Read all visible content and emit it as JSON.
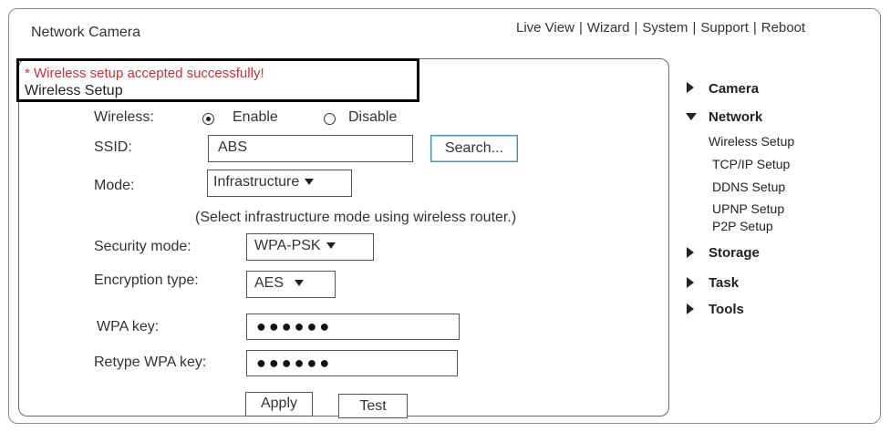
{
  "header": {
    "title": "Network Camera",
    "nav": [
      "Live View",
      "Wizard",
      "System",
      "Support",
      "Reboot"
    ]
  },
  "form": {
    "message": "* Wireless setup accepted successfully!",
    "section_title": "Wireless Setup",
    "wireless_label": "Wireless:",
    "enable_label": "Enable",
    "disable_label": "Disable",
    "wireless_selected": "Enable",
    "ssid_label": "SSID:",
    "ssid_value": "ABS",
    "search_label": "Search...",
    "mode_label": "Mode:",
    "mode_value": "Infrastructure",
    "mode_hint": "(Select infrastructure mode using wireless router.)",
    "security_label": "Security mode:",
    "security_value": "WPA-PSK",
    "encryption_label": "Encryption type:",
    "encryption_value": "AES",
    "wpa_key_label": "WPA key:",
    "wpa_key_value": "●●●●●●",
    "retype_label": "Retype WPA key:",
    "retype_value": "●●●●●●",
    "apply_label": "Apply",
    "test_label": "Test"
  },
  "sidebar": {
    "sections": [
      {
        "label": "Camera",
        "expanded": false
      },
      {
        "label": "Network",
        "expanded": true
      },
      {
        "label": "Storage",
        "expanded": false
      },
      {
        "label": "Task",
        "expanded": false
      },
      {
        "label": "Tools",
        "expanded": false
      }
    ],
    "network_items": [
      "Wireless Setup",
      "TCP/IP Setup",
      "DDNS Setup",
      "UPNP Setup",
      "P2P Setup"
    ]
  },
  "colors": {
    "message": "#c8323a",
    "search_border": "#4a8fbf"
  }
}
